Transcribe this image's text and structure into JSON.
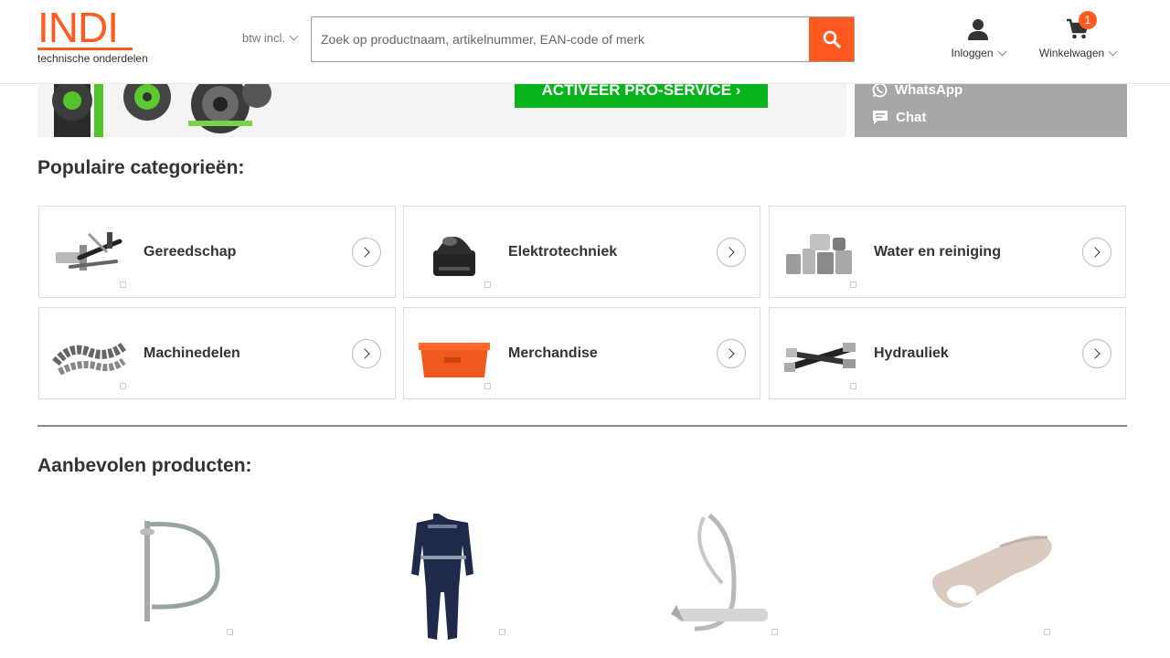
{
  "header": {
    "logo_text": "INDI",
    "logo_subtitle": "technische onderdelen",
    "vat_selector": "btw incl.",
    "search_placeholder": "Zoek op productnaam, artikelnummer, EAN-code of merk",
    "login_label": "Inloggen",
    "cart_label": "Winkelwagen",
    "cart_count": "1"
  },
  "banner": {
    "cta_label": "ACTIVEER PRO-SERVICE"
  },
  "contact": {
    "whatsapp_label": "WhatsApp",
    "chat_label": "Chat"
  },
  "categories_section": {
    "title": "Populaire categorieën:",
    "items": [
      {
        "label": "Gereedschap",
        "icon": "tools-icon"
      },
      {
        "label": "Elektrotechniek",
        "icon": "switch-icon"
      },
      {
        "label": "Water en reiniging",
        "icon": "fittings-icon"
      },
      {
        "label": "Machinedelen",
        "icon": "chain-icon"
      },
      {
        "label": "Merchandise",
        "icon": "toolbox-icon"
      },
      {
        "label": "Hydrauliek",
        "icon": "hose-icon"
      }
    ]
  },
  "products_section": {
    "title": "Aanbevolen producten:",
    "items": [
      {
        "icon": "linch-pin-icon"
      },
      {
        "icon": "overall-icon"
      },
      {
        "icon": "spring-clip-icon"
      },
      {
        "icon": "cable-lug-icon"
      }
    ]
  },
  "colors": {
    "brand": "#ff5a1f",
    "cta_green": "#09b31c",
    "contact_grey": "#a7a7a7"
  }
}
